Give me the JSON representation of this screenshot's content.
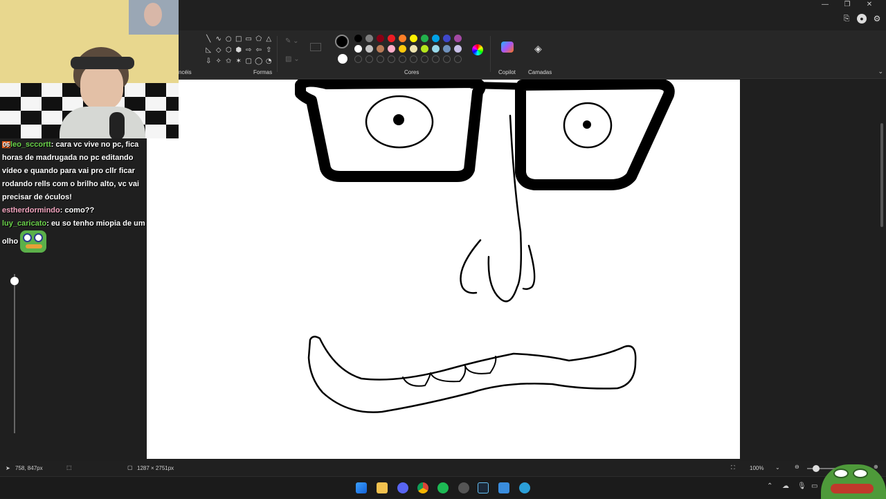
{
  "window": {
    "controls": [
      "—",
      "❐",
      "✕"
    ]
  },
  "ribbon": {
    "groups": {
      "brushes_partial": "ncéis",
      "shapes": "Formas",
      "colors": "Cores",
      "copilot": "Copilot",
      "layers": "Camadas"
    },
    "shapes": [
      "╲",
      "∿",
      "○",
      "□",
      "▭",
      "⬠",
      "△",
      "◺",
      "◇",
      "⬡",
      "⬢",
      "⇨",
      "⇦",
      "⇧",
      "⇩",
      "✧",
      "✩",
      "✶",
      "▢",
      "◯",
      "◔"
    ],
    "palette_row1": [
      "#000000",
      "#7f7f7f",
      "#880015",
      "#ed1c24",
      "#ff7f27",
      "#fff200",
      "#22b14c",
      "#00a2e8",
      "#3f48cc",
      "#a349a4"
    ],
    "palette_row2": [
      "#ffffff",
      "#c3c3c3",
      "#b97a57",
      "#ffaec9",
      "#ffc90e",
      "#efe4b0",
      "#b5e61d",
      "#99d9ea",
      "#7092be",
      "#c8bfe7"
    ],
    "primary_color": "#000000",
    "secondary_color": "#ffffff"
  },
  "chat": [
    {
      "user": "leo_sccortt",
      "user_color": "#6ad14a",
      "badge": "06",
      "text": "cara vc vive no pc, fica horas de madrugada no pc editando vídeo e quando para vai pro cllr ficar rodando rells com o brilho alto, vc vai precisar de óculos!"
    },
    {
      "user": "estherdormindo",
      "user_color": "#f4a6c0",
      "text": "como??"
    },
    {
      "user": "luy_caricato",
      "user_color": "#6ad14a",
      "text": "eu so tenho miopia de um olho"
    }
  ],
  "status": {
    "cursor": "758, 847px",
    "canvas_size": "1287 × 2751px",
    "zoom": "100%"
  }
}
